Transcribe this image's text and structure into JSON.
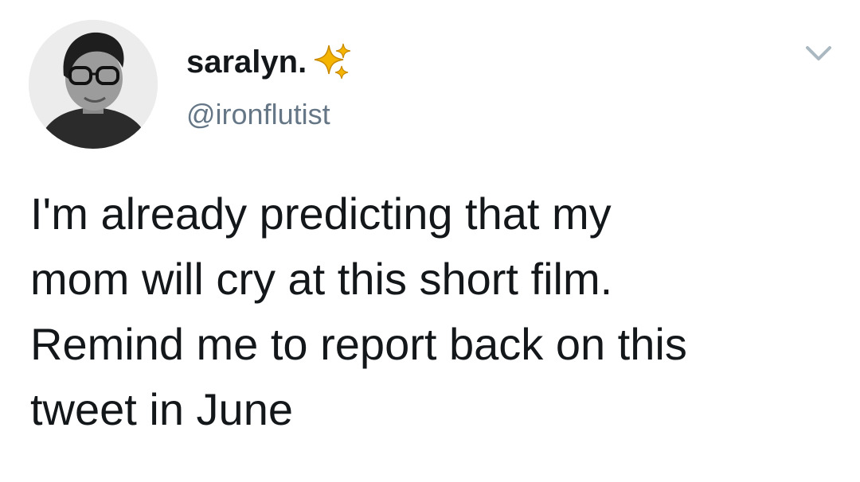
{
  "author": {
    "display_name": "saralyn.",
    "handle": "@ironflutist",
    "name_emoji_icon": "sparkles-icon",
    "avatar_icon": "avatar-photo"
  },
  "menu": {
    "icon": "chevron-down-icon"
  },
  "tweet": {
    "text": "I'm already predicting that my\nmom will cry at this short film.\nRemind me to report back on this\ntweet in June"
  },
  "colors": {
    "text_primary": "#14171a",
    "text_secondary": "#657786",
    "sparkle_gold": "#f4b400",
    "chevron_gray": "#aab8c2"
  }
}
